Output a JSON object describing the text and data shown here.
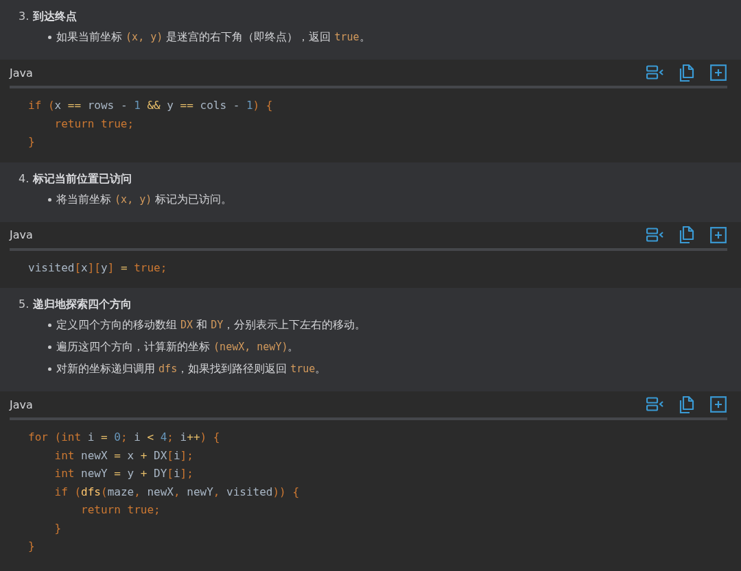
{
  "sections": [
    {
      "kind": "step",
      "number": "3.",
      "title": "到达终点",
      "bullets": [
        [
          {
            "kind": "text",
            "text": "如果当前坐标 "
          },
          {
            "kind": "code",
            "text": "(x, y)"
          },
          {
            "kind": "text",
            "text": " 是迷宫的右下角（即终点），返回 "
          },
          {
            "kind": "code",
            "text": "true"
          },
          {
            "kind": "text",
            "text": "。"
          }
        ]
      ]
    },
    {
      "kind": "code",
      "language": "Java",
      "lines": [
        [
          {
            "kind": "kw",
            "text": "if "
          },
          {
            "kind": "punct",
            "text": "("
          },
          {
            "kind": "plain",
            "text": "x "
          },
          {
            "kind": "op",
            "text": "=="
          },
          {
            "kind": "plain",
            "text": " rows - "
          },
          {
            "kind": "num",
            "text": "1"
          },
          {
            "kind": "op",
            "text": " &&"
          },
          {
            "kind": "plain",
            "text": " y "
          },
          {
            "kind": "op",
            "text": "=="
          },
          {
            "kind": "plain",
            "text": " cols - "
          },
          {
            "kind": "num",
            "text": "1"
          },
          {
            "kind": "punct",
            "text": ") {"
          }
        ],
        [
          {
            "kind": "kw",
            "text": "    return true"
          },
          {
            "kind": "punct",
            "text": ";"
          }
        ],
        [
          {
            "kind": "punct",
            "text": "}"
          }
        ]
      ]
    },
    {
      "kind": "step",
      "number": "4.",
      "title": "标记当前位置已访问",
      "bullets": [
        [
          {
            "kind": "text",
            "text": "将当前坐标 "
          },
          {
            "kind": "code",
            "text": "(x, y)"
          },
          {
            "kind": "text",
            "text": " 标记为已访问。"
          }
        ]
      ]
    },
    {
      "kind": "code",
      "language": "Java",
      "lines": [
        [
          {
            "kind": "plain",
            "text": "visited"
          },
          {
            "kind": "punct",
            "text": "["
          },
          {
            "kind": "plain",
            "text": "x"
          },
          {
            "kind": "punct",
            "text": "]["
          },
          {
            "kind": "plain",
            "text": "y"
          },
          {
            "kind": "punct",
            "text": "]"
          },
          {
            "kind": "op",
            "text": " ="
          },
          {
            "kind": "kw",
            "text": " true"
          },
          {
            "kind": "punct",
            "text": ";"
          }
        ]
      ]
    },
    {
      "kind": "step",
      "number": "5.",
      "title": "递归地探索四个方向",
      "bullets": [
        [
          {
            "kind": "text",
            "text": "定义四个方向的移动数组 "
          },
          {
            "kind": "code",
            "text": "DX"
          },
          {
            "kind": "text",
            "text": " 和 "
          },
          {
            "kind": "code",
            "text": "DY"
          },
          {
            "kind": "text",
            "text": "，分别表示上下左右的移动。"
          }
        ],
        [
          {
            "kind": "text",
            "text": "遍历这四个方向，计算新的坐标 "
          },
          {
            "kind": "code",
            "text": "(newX, newY)"
          },
          {
            "kind": "text",
            "text": "。"
          }
        ],
        [
          {
            "kind": "text",
            "text": "对新的坐标递归调用 "
          },
          {
            "kind": "code",
            "text": "dfs"
          },
          {
            "kind": "text",
            "text": "，如果找到路径则返回 "
          },
          {
            "kind": "code",
            "text": "true"
          },
          {
            "kind": "text",
            "text": "。"
          }
        ]
      ]
    },
    {
      "kind": "code",
      "language": "Java",
      "lines": [
        [
          {
            "kind": "kw",
            "text": "for "
          },
          {
            "kind": "punct",
            "text": "("
          },
          {
            "kind": "kw",
            "text": "int"
          },
          {
            "kind": "plain",
            "text": " i "
          },
          {
            "kind": "op",
            "text": "="
          },
          {
            "kind": "num",
            "text": " 0"
          },
          {
            "kind": "punct",
            "text": ";"
          },
          {
            "kind": "plain",
            "text": " i "
          },
          {
            "kind": "op",
            "text": "<"
          },
          {
            "kind": "num",
            "text": " 4"
          },
          {
            "kind": "punct",
            "text": ";"
          },
          {
            "kind": "plain",
            "text": " i"
          },
          {
            "kind": "op",
            "text": "++"
          },
          {
            "kind": "punct",
            "text": ") {"
          }
        ],
        [
          {
            "kind": "kw",
            "text": "    int"
          },
          {
            "kind": "plain",
            "text": " newX "
          },
          {
            "kind": "op",
            "text": "="
          },
          {
            "kind": "plain",
            "text": " x "
          },
          {
            "kind": "op",
            "text": "+"
          },
          {
            "kind": "plain",
            "text": " DX"
          },
          {
            "kind": "punct",
            "text": "["
          },
          {
            "kind": "plain",
            "text": "i"
          },
          {
            "kind": "punct",
            "text": "];"
          }
        ],
        [
          {
            "kind": "kw",
            "text": "    int"
          },
          {
            "kind": "plain",
            "text": " newY "
          },
          {
            "kind": "op",
            "text": "="
          },
          {
            "kind": "plain",
            "text": " y "
          },
          {
            "kind": "op",
            "text": "+"
          },
          {
            "kind": "plain",
            "text": " DY"
          },
          {
            "kind": "punct",
            "text": "["
          },
          {
            "kind": "plain",
            "text": "i"
          },
          {
            "kind": "punct",
            "text": "];"
          }
        ],
        [
          {
            "kind": "kw",
            "text": "    if "
          },
          {
            "kind": "punct",
            "text": "("
          },
          {
            "kind": "fn",
            "text": "dfs"
          },
          {
            "kind": "punct",
            "text": "("
          },
          {
            "kind": "plain",
            "text": "maze"
          },
          {
            "kind": "punct",
            "text": ","
          },
          {
            "kind": "plain",
            "text": " newX"
          },
          {
            "kind": "punct",
            "text": ","
          },
          {
            "kind": "plain",
            "text": " newY"
          },
          {
            "kind": "punct",
            "text": ","
          },
          {
            "kind": "plain",
            "text": " visited"
          },
          {
            "kind": "punct",
            "text": ")) {"
          }
        ],
        [
          {
            "kind": "kw",
            "text": "        return true"
          },
          {
            "kind": "punct",
            "text": ";"
          }
        ],
        [
          {
            "kind": "punct",
            "text": "    }"
          }
        ],
        [
          {
            "kind": "punct",
            "text": "}"
          }
        ]
      ]
    }
  ]
}
